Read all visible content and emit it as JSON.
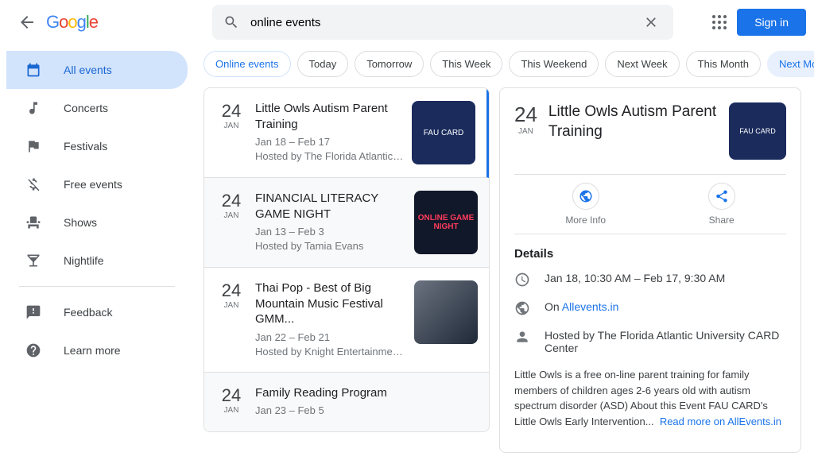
{
  "search": {
    "query": "online events"
  },
  "header": {
    "signin": "Sign in"
  },
  "sidebar": [
    {
      "label": "All events"
    },
    {
      "label": "Concerts"
    },
    {
      "label": "Festivals"
    },
    {
      "label": "Free events"
    },
    {
      "label": "Shows"
    },
    {
      "label": "Nightlife"
    },
    {
      "label": "Feedback"
    },
    {
      "label": "Learn more"
    }
  ],
  "chips": [
    "Online events",
    "Today",
    "Tomorrow",
    "This Week",
    "This Weekend",
    "Next Week",
    "This Month",
    "Next Month"
  ],
  "events": [
    {
      "day": "24",
      "month": "JAN",
      "title": "Little Owls Autism Parent Training",
      "dates": "Jan 18 – Feb 17",
      "host": "Hosted by The Florida Atlantic U...",
      "thumb": "FAU CARD"
    },
    {
      "day": "24",
      "month": "JAN",
      "title": "FINANCIAL LITERACY GAME NIGHT",
      "dates": "Jan 13 – Feb 3",
      "host": "Hosted by Tamia Evans",
      "thumb": "ONLINE GAME NIGHT"
    },
    {
      "day": "24",
      "month": "JAN",
      "title": "Thai Pop - Best of Big Mountain Music Festival GMM...",
      "dates": "Jan 22 – Feb 21",
      "host": "Hosted by Knight Entertainment ...",
      "thumb": ""
    },
    {
      "day": "24",
      "month": "JAN",
      "title": "Family Reading Program",
      "dates": "Jan 23 – Feb 5",
      "host": "",
      "thumb": ""
    }
  ],
  "detail": {
    "day": "24",
    "month": "JAN",
    "title": "Little Owls Autism Parent Training",
    "thumb": "FAU CARD",
    "actions": {
      "more": "More Info",
      "share": "Share"
    },
    "sectionTitle": "Details",
    "when": "Jan 18, 10:30 AM – Feb 17, 9:30 AM",
    "onPrefix": "On ",
    "onLink": "Allevents.in",
    "host": "Hosted by The Florida Atlantic University CARD Center",
    "desc": "Little Owls is a free on-line parent training for family members of children ages 2-6 years old with autism spectrum disorder (ASD) About this Event FAU CARD's Little Owls Early Intervention...",
    "readMore": "Read more on AllEvents.in"
  }
}
